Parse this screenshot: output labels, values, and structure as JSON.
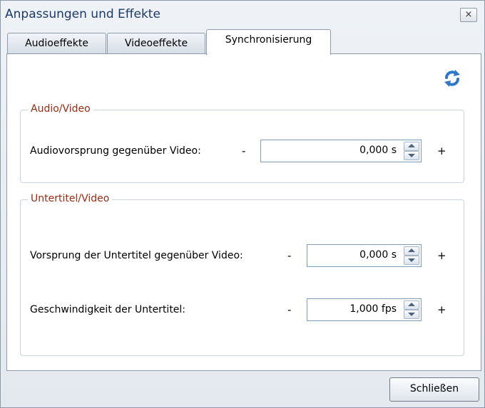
{
  "window": {
    "title": "Anpassungen und Effekte",
    "close_glyph": "×"
  },
  "tabs": [
    {
      "label": "Audioeffekte",
      "active": false
    },
    {
      "label": "Videoeffekte",
      "active": false
    },
    {
      "label": "Synchronisierung",
      "active": true
    }
  ],
  "sync_icon": "refresh-icon",
  "groups": {
    "audio_video": {
      "title": "Audio/Video",
      "rows": [
        {
          "label": "Audiovorsprung gegenüber Video:",
          "minus": "-",
          "value": "0,000 s",
          "plus": "+"
        }
      ]
    },
    "subtitle_video": {
      "title": "Untertitel/Video",
      "rows": [
        {
          "label": "Vorsprung der Untertitel gegenüber Video:",
          "minus": "-",
          "value": "0,000 s",
          "plus": "+"
        },
        {
          "label": "Geschwindigkeit der Untertitel:",
          "minus": "-",
          "value": "1,000 fps",
          "plus": "+"
        }
      ]
    }
  },
  "footer": {
    "close_label": "Schließen"
  },
  "colors": {
    "group_title": "#9b2a12",
    "title_text": "#1d3a66",
    "accent_icon": "#2f78c8"
  }
}
